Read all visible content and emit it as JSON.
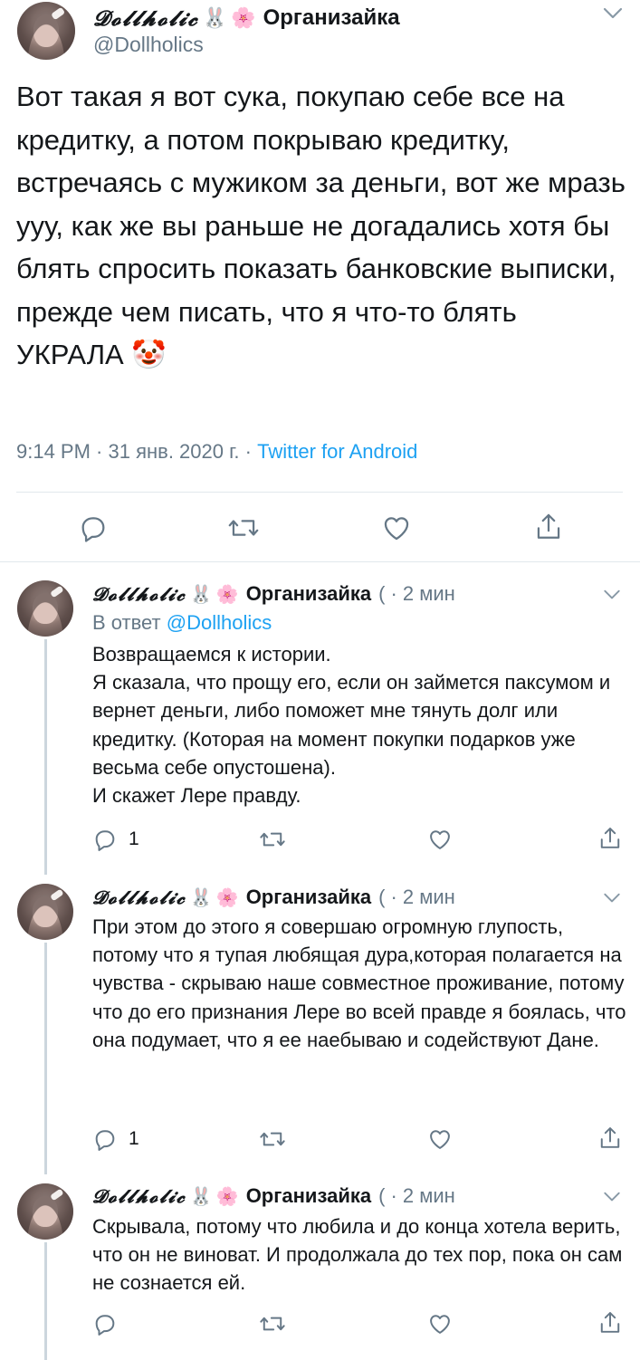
{
  "main_tweet": {
    "display_name": "𝓓𝓸𝓵𝓵𝓱𝓸𝓵𝓲𝓬",
    "emoji_bunny": "🐰",
    "emoji_flower": "🌸",
    "suffix": "Организайка",
    "handle": "@Dollholics",
    "text": "Вот такая я вот сука, покупаю себе все на кредитку, а потом покрываю кредитку, встречаясь с мужиком за деньги, вот же мразь ууу, как же вы раньше не догадались хотя бы блять спросить показать банковские выписки, прежде чем писать, что я что-то блять УКРАЛА",
    "emoji_clown": "🤡",
    "time": "9:14 PM · 31 янв. 2020 г. · ",
    "source": "Twitter for Android"
  },
  "replies": [
    {
      "display_name": "𝓓𝓸𝓵𝓵𝓱𝓸𝓵𝓲𝓬",
      "emoji_bunny": "🐰",
      "emoji_flower": "🌸",
      "suffix": "Организайка",
      "handle_cut": "(",
      "time": "· 2 мин",
      "reply_prefix": "В ответ ",
      "reply_handle": "@Dollholics",
      "text": "Возвращаемся к истории.\nЯ сказала, что прощу его, если он займется паксумом и вернет деньги, либо поможет мне тянуть долг или кредитку. (Которая на момент покупки подарков уже весьма себе опустошена).\nИ скажет Лере правду.",
      "reply_count": "1"
    },
    {
      "display_name": "𝓓𝓸𝓵𝓵𝓱𝓸𝓵𝓲𝓬",
      "emoji_bunny": "🐰",
      "emoji_flower": "🌸",
      "suffix": "Организайка",
      "handle_cut": "(",
      "time": "· 2 мин",
      "text": "При этом до этого я совершаю огромную глупость, потому что я тупая любящая дура,которая полагается на чувства - скрываю наше совместное проживание, потому что до его признания Лере во всей правде я боялась, что она подумает, что я ее наебываю и содействуют Дане.",
      "reply_count": "1"
    },
    {
      "display_name": "𝓓𝓸𝓵𝓵𝓱𝓸𝓵𝓲𝓬",
      "emoji_bunny": "🐰",
      "emoji_flower": "🌸",
      "suffix": "Организайка",
      "handle_cut": "(",
      "time": "· 2 мин",
      "text": "Скрывала, потому что любила и до конца хотела верить, что он не виноват. И продолжала до тех пор, пока он сам не сознается ей.",
      "reply_count": ""
    }
  ]
}
